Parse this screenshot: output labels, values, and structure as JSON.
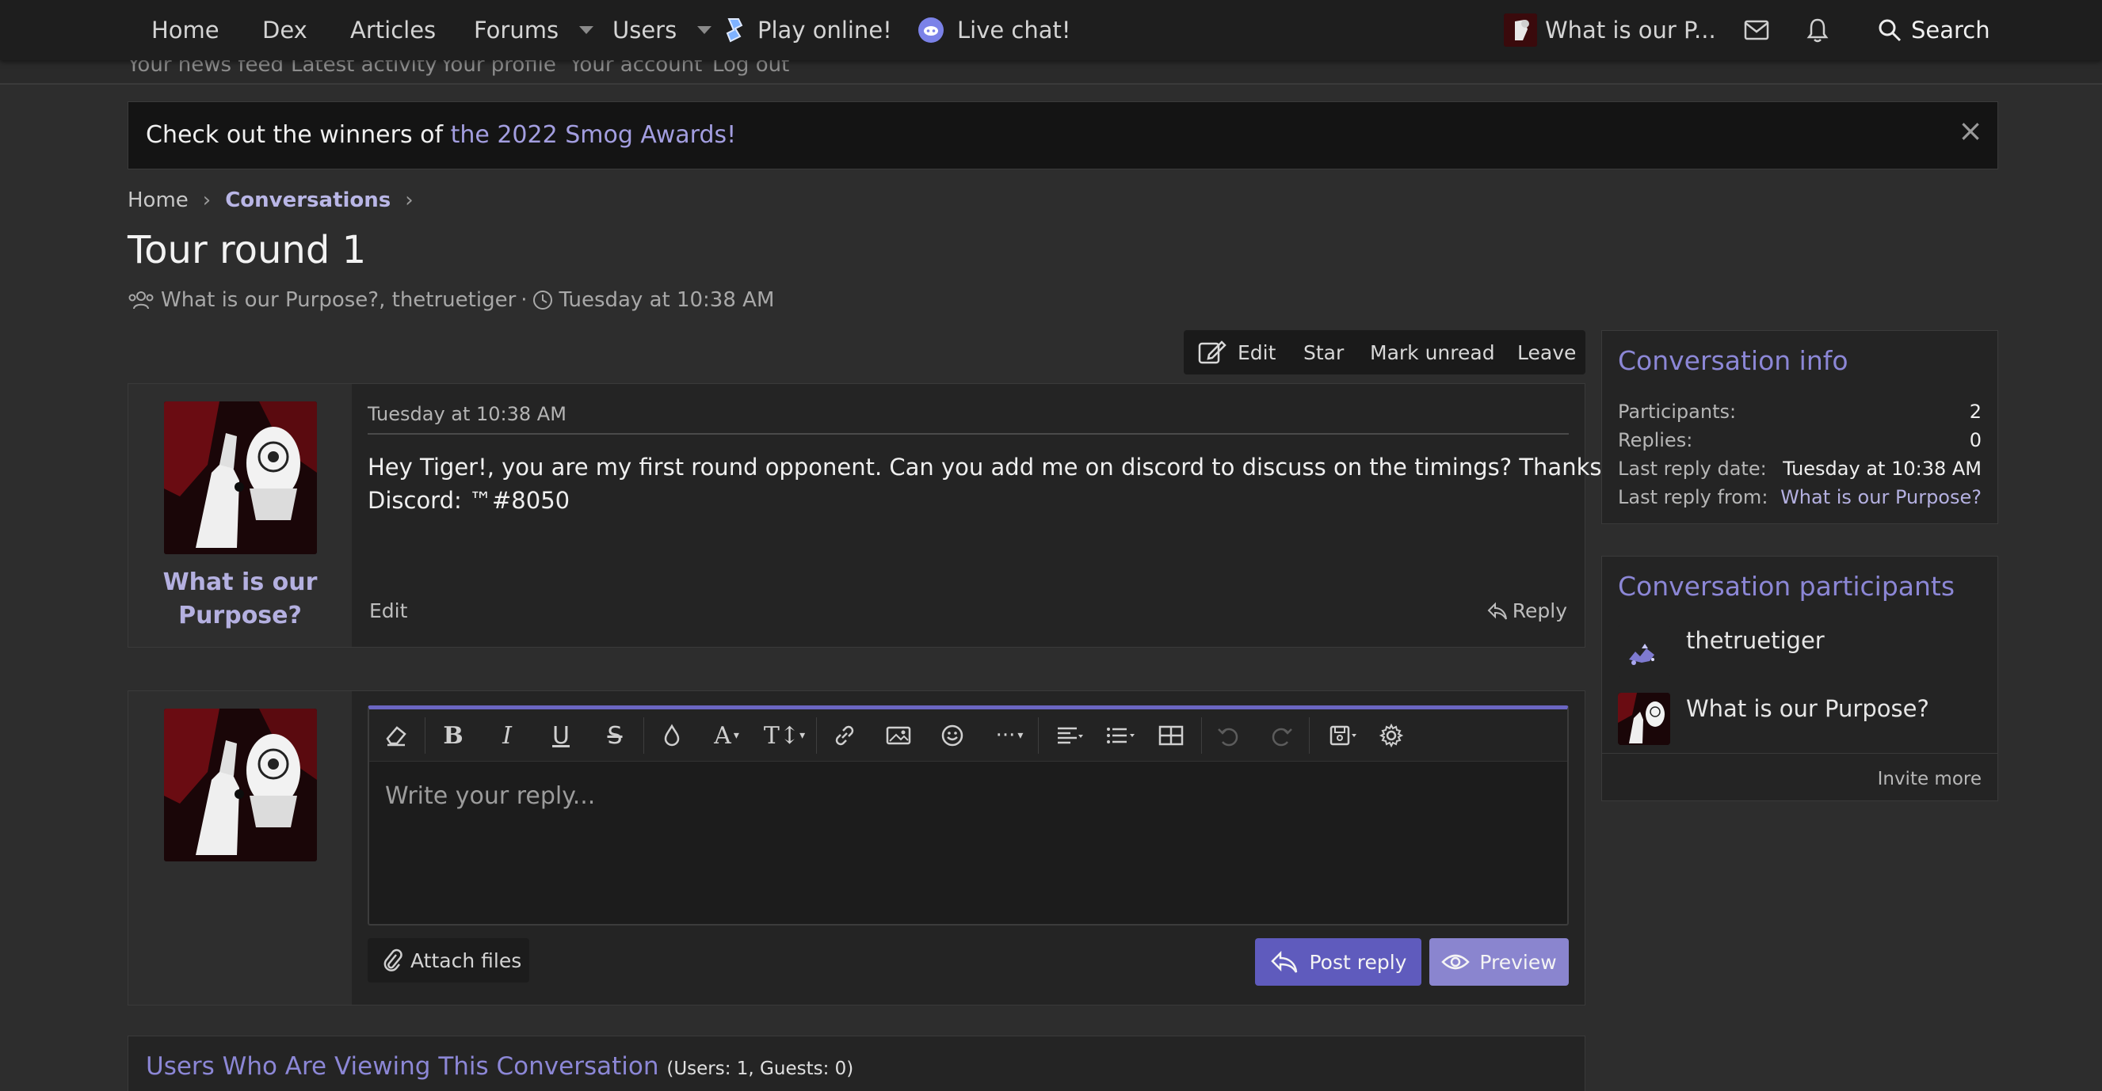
{
  "nav": {
    "home": "Home",
    "dex": "Dex",
    "articles": "Articles",
    "forums": "Forums",
    "users": "Users",
    "play_online": "Play online!",
    "live_chat": "Live chat!",
    "account_name": "What is our P...",
    "search": "Search"
  },
  "subnav": {
    "items": [
      "Your news feed",
      "Latest activity",
      "Your profile",
      "Your account",
      "Log out"
    ]
  },
  "notice": {
    "text": "Check out the winners of ",
    "link": "the 2022 Smog Awards!",
    "close": "×"
  },
  "breadcrumb": {
    "home": "Home",
    "conversations": "Conversations"
  },
  "page": {
    "title": "Tour round 1",
    "participants": "What is our Purpose?, thetruetiger",
    "separator": "·",
    "date": "Tuesday at 10:38 AM"
  },
  "actions": {
    "edit": "Edit",
    "star": "Star",
    "mark_unread": "Mark unread",
    "leave": "Leave"
  },
  "post": {
    "username_line1": "What is our",
    "username_line2": "Purpose?",
    "date": "Tuesday at 10:38 AM",
    "body_line1": "Hey Tiger!, you are my first round opponent. Can you add me on discord to discuss on the timings? Thanks.",
    "body_line2": "Discord: ™#8050",
    "edit": "Edit",
    "reply": "Reply"
  },
  "reply_box": {
    "placeholder": "Write your reply...",
    "attach": "Attach files",
    "post_reply": "Post reply",
    "preview": "Preview"
  },
  "viewers": {
    "title": "Users Who Are Viewing This Conversation",
    "count": "(Users: 1, Guests: 0)"
  },
  "conversation_info": {
    "title": "Conversation info",
    "rows": [
      {
        "label": "Participants:",
        "value": "2"
      },
      {
        "label": "Replies:",
        "value": "0"
      },
      {
        "label": "Last reply date:",
        "value": "Tuesday at 10:38 AM"
      },
      {
        "label": "Last reply from:",
        "value": "What is our Purpose?"
      }
    ]
  },
  "participants_block": {
    "title": "Conversation participants",
    "people": [
      "thetruetiger",
      "What is our Purpose?"
    ],
    "invite": "Invite more"
  },
  "colors": {
    "accent": "#8c87d6",
    "link": "#b4b0e0",
    "button": "#5f5bbd",
    "button_light": "#8a85cf",
    "nav_bg": "#1e1e1e",
    "page_bg": "#2d2d2d"
  }
}
